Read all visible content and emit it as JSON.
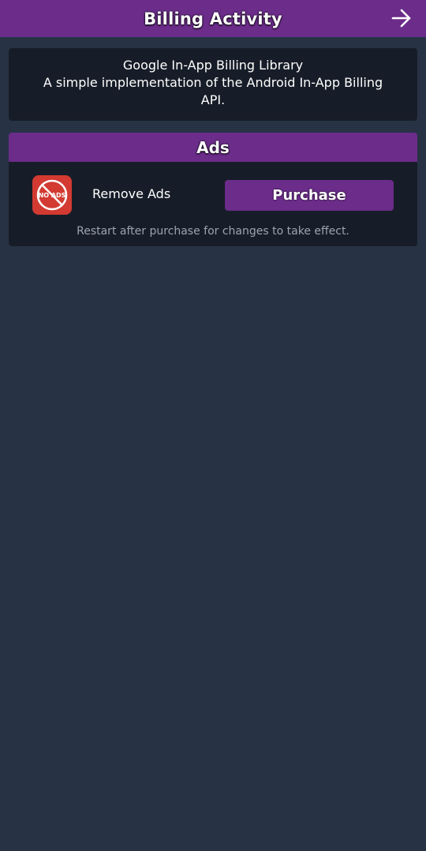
{
  "header": {
    "title": "Billing Activity",
    "forward_icon": "arrow-right-icon"
  },
  "info": {
    "line1": "Google In-App Billing Library",
    "line2": "A simple implementation of the Android In-App Billing",
    "line3": "API."
  },
  "ads_section": {
    "title": "Ads",
    "item": {
      "icon": "no-ads-icon",
      "icon_text": "NO ADS",
      "label": "Remove Ads",
      "button_label": "Purchase"
    },
    "note": "Restart after purchase for changes to take effect."
  },
  "colors": {
    "background": "#273345",
    "card": "#171d28",
    "accent": "#6b2c8a",
    "icon_red": "#d23a32",
    "muted_text": "#9ea4ae"
  }
}
